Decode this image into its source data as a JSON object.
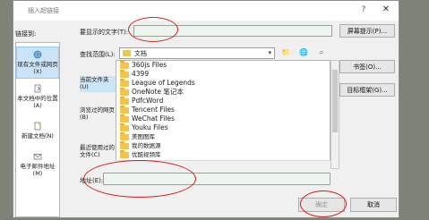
{
  "window": {
    "title": "插入超链接",
    "help": "?",
    "close": "✕"
  },
  "link_to": {
    "label": "链接到:",
    "items": [
      {
        "label": "现有文件或网页(X)",
        "icon": "globe-icon",
        "selected": true
      },
      {
        "label": "本文档中的位置(A)",
        "icon": "document-place-icon",
        "selected": false
      },
      {
        "label": "新建文档(N)",
        "icon": "new-document-icon",
        "selected": false
      },
      {
        "label": "电子邮件地址(M)",
        "icon": "email-icon",
        "selected": false
      }
    ]
  },
  "display_text": {
    "label": "要显示的文字(T):",
    "value": ""
  },
  "screentip_button": "屏幕提示(P)...",
  "look_in": {
    "label": "查找范围(L):",
    "value": "文档"
  },
  "side_options": [
    {
      "label": "当前文件夹(U)",
      "selected": true
    },
    {
      "label": "浏览过的网页(B)",
      "selected": false
    },
    {
      "label": "最近使用过的文件(C)",
      "selected": false
    }
  ],
  "files": [
    "360js Files",
    "4399",
    "League of Legends",
    "OneNote 笔记本",
    "PdfcWord",
    "Tencent Files",
    "WeChat Files",
    "Youku Files",
    "美图图库",
    "我的数据源",
    "优酷视频库"
  ],
  "bookmark_button": "书签(O)...",
  "target_frame_button": "目标框架(G)...",
  "address": {
    "label": "地址(E):",
    "value": ""
  },
  "ok_button": "确定",
  "cancel_button": "取消"
}
